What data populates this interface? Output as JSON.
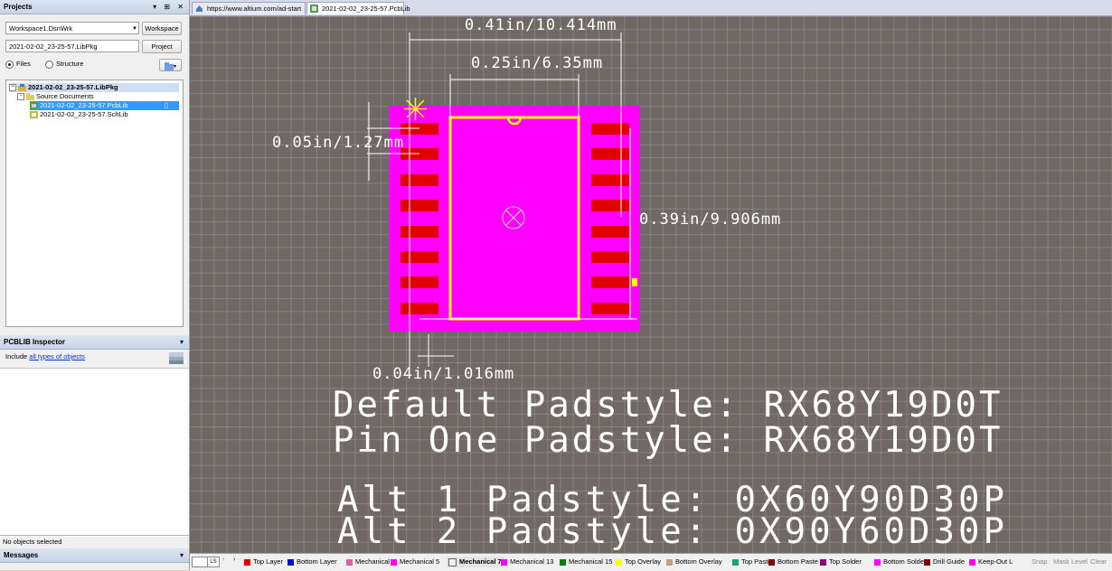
{
  "projects_panel": {
    "title": "Projects",
    "workspace_combo": "Workspace1.DsnWrk",
    "workspace_button": "Workspace",
    "project_field": "2021-02-02_23-25-57.LibPkg",
    "project_button": "Project",
    "view_files": "Files",
    "view_structure": "Structure",
    "tree": {
      "root": "2021-02-02_23-25-57.LibPkg",
      "folder": "Source Documents",
      "doc1": "2021-02-02_23-25-57.PcbLib",
      "doc2": "2021-02-02_23-25-57.SchLib"
    }
  },
  "inspector": {
    "title": "PCBLIB Inspector",
    "include_prefix": "Include",
    "include_link": "all types of objects"
  },
  "status_left": "No objects selected",
  "messages_title": "Messages",
  "tabs": [
    {
      "label": "https://www.altium.com/ad-start"
    },
    {
      "label": "2021-02-02_23-25-57.PcbLib"
    }
  ],
  "dimensions": {
    "overall_width": "0.41in/10.414mm",
    "body_width": "0.25in/6.35mm",
    "pitch": "0.05in/1.27mm",
    "height": "0.39in/9.906mm",
    "pad_width": "0.04in/1.016mm"
  },
  "notes": {
    "line1": "Default Padstyle: RX68Y19D0T",
    "line2": "Pin One Padstyle: RX68Y19D0T",
    "line3": "Alt 1 Padstyle: 0X60Y90D30P",
    "line4": "Alt 2 Padstyle: 0X90Y60D30P"
  },
  "layer_bar": {
    "ls_label": "LS",
    "layers": [
      {
        "name": "Top Layer",
        "color": "#e00000"
      },
      {
        "name": "Bottom Layer",
        "color": "#0000e0"
      },
      {
        "name": "Mechanical 1",
        "color": "#e060a0"
      },
      {
        "name": "Mechanical 5",
        "color": "#ff00ff"
      },
      {
        "name": "Mechanical 7",
        "color": "#f0f0f0"
      },
      {
        "name": "Mechanical 13",
        "color": "#ff00ff"
      },
      {
        "name": "Mechanical 15",
        "color": "#008000"
      },
      {
        "name": "Top Overlay",
        "color": "#ffff00"
      },
      {
        "name": "Bottom Overlay",
        "color": "#c0a080"
      },
      {
        "name": "Top Paste",
        "color": "#20a080"
      },
      {
        "name": "Bottom Paste",
        "color": "#800000"
      },
      {
        "name": "Top Solder",
        "color": "#800080"
      },
      {
        "name": "Bottom Solder",
        "color": "#ff00ff"
      },
      {
        "name": "Drill Guide",
        "color": "#800000"
      },
      {
        "name": "Keep-Out L",
        "color": "#ff00ff"
      }
    ],
    "snap": "Snap",
    "mask_level": "Mask Level",
    "clear": "Clear"
  },
  "colors": {
    "canvas": "#6f6865",
    "body": "#ff00ff",
    "pad": "#e00000",
    "overlay": "#ffff00"
  }
}
